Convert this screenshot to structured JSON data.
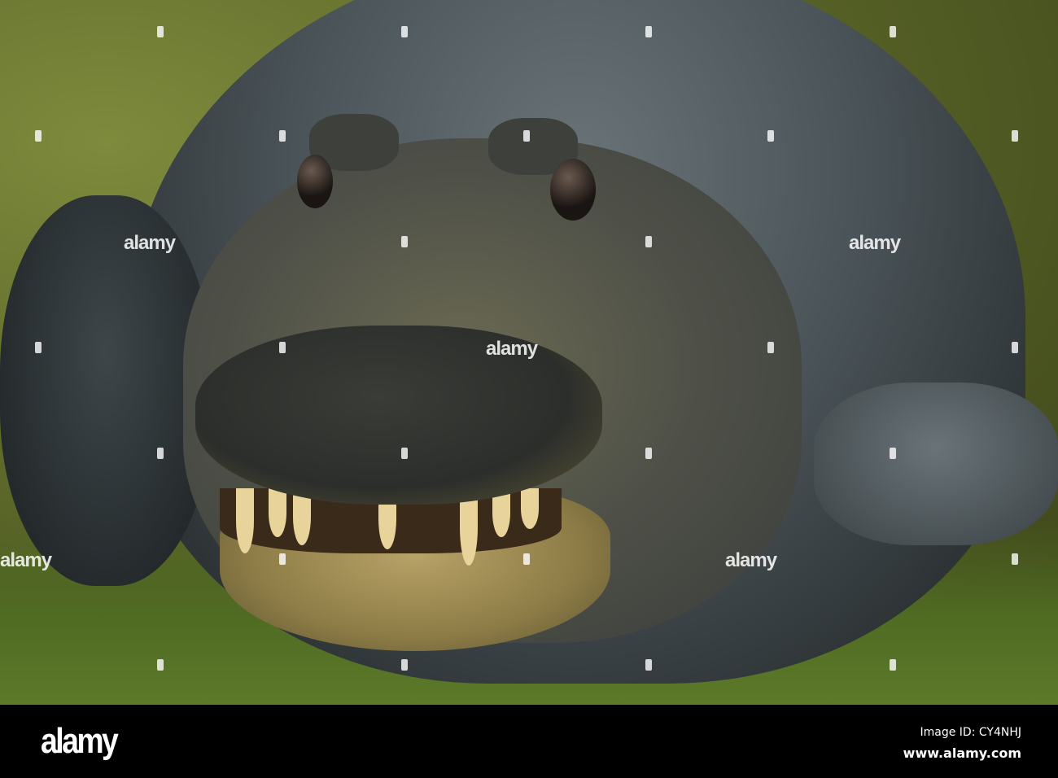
{
  "photo": {
    "subject": "caiman",
    "watermark_text": "alamy"
  },
  "footer": {
    "logo": "alamy",
    "image_id": "Image ID: CY4NHJ",
    "url": "www.alamy.com"
  }
}
